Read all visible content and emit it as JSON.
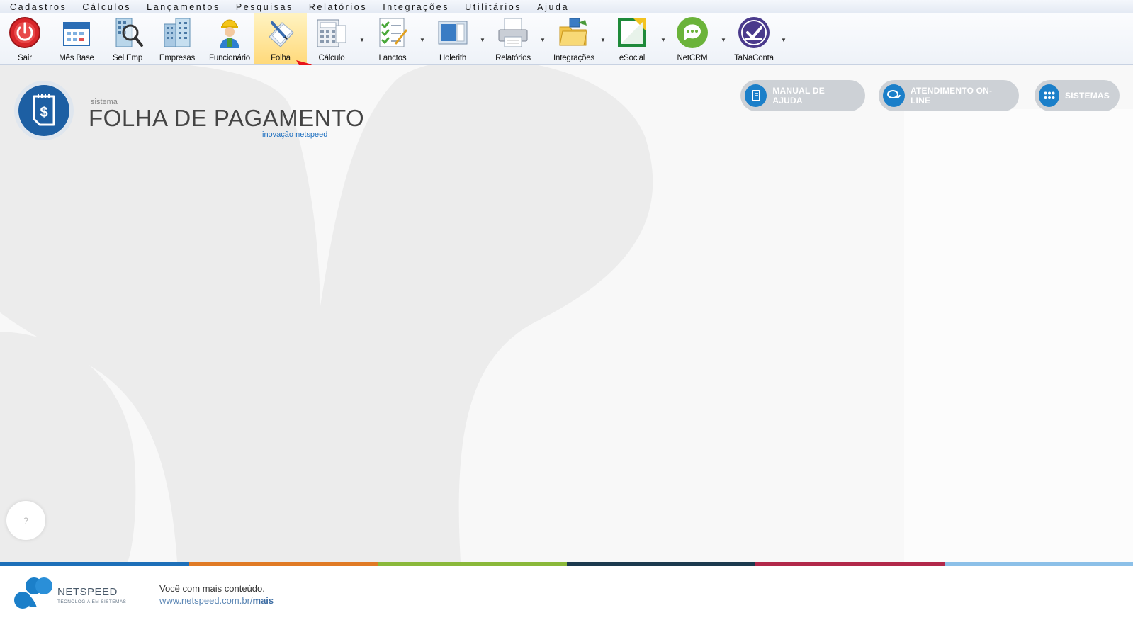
{
  "menu": [
    {
      "pre": "",
      "ul": "C",
      "post": "adastros"
    },
    {
      "pre": "Cálculo",
      "ul": "s",
      "post": ""
    },
    {
      "pre": "",
      "ul": "L",
      "post": "ançamentos"
    },
    {
      "pre": "",
      "ul": "P",
      "post": "esquisas"
    },
    {
      "pre": "",
      "ul": "R",
      "post": "elatórios"
    },
    {
      "pre": "",
      "ul": "I",
      "post": "ntegrações"
    },
    {
      "pre": "",
      "ul": "U",
      "post": "tilitários"
    },
    {
      "pre": "Aju",
      "ul": "d",
      "post": "a"
    }
  ],
  "toolbar": [
    {
      "label": "Sair",
      "icon": "power-icon"
    },
    {
      "label": "Mês Base",
      "icon": "calendar-icon"
    },
    {
      "label": "Sel Emp",
      "icon": "building-search-icon"
    },
    {
      "label": "Empresas",
      "icon": "buildings-icon"
    },
    {
      "label": "Funcionário",
      "icon": "worker-icon"
    },
    {
      "label": "Folha",
      "icon": "paper-pen-icon",
      "active": true
    },
    {
      "label": "Cálculo",
      "icon": "calculator-icon"
    },
    {
      "label": "Lanctos",
      "icon": "checklist-icon"
    },
    {
      "label": "Holerith",
      "icon": "document-icon"
    },
    {
      "label": "Relatórios",
      "icon": "printer-icon"
    },
    {
      "label": "Integrações",
      "icon": "folders-icon"
    },
    {
      "label": "eSocial",
      "icon": "esocial-icon"
    },
    {
      "label": "NetCRM",
      "icon": "chat-icon"
    },
    {
      "label": "TaNaConta",
      "icon": "check-badge-icon"
    }
  ],
  "brand": {
    "small": "sistema",
    "title": "FOLHA DE PAGAMENTO",
    "tagline": "inovação netspeed"
  },
  "actions": {
    "manual": "MANUAL DE AJUDA",
    "atendimento": "ATENDIMENTO ON-LINE",
    "sistemas": "SISTEMAS"
  },
  "help_bubble": "?",
  "footer": {
    "brand": "NETSPEED",
    "brand_sub": "TECNOLOGIA EM SISTEMAS",
    "text": "Você com mais conteúdo.",
    "link_prefix": "www.netspeed.com.br/",
    "link_bold": "mais"
  },
  "colors": {
    "strip": [
      "#1d6fb8",
      "#e07a25",
      "#8ab83a",
      "#1c3a4e",
      "#b2284a",
      "#8cc0e8"
    ],
    "accent": "#1d6fc0"
  }
}
